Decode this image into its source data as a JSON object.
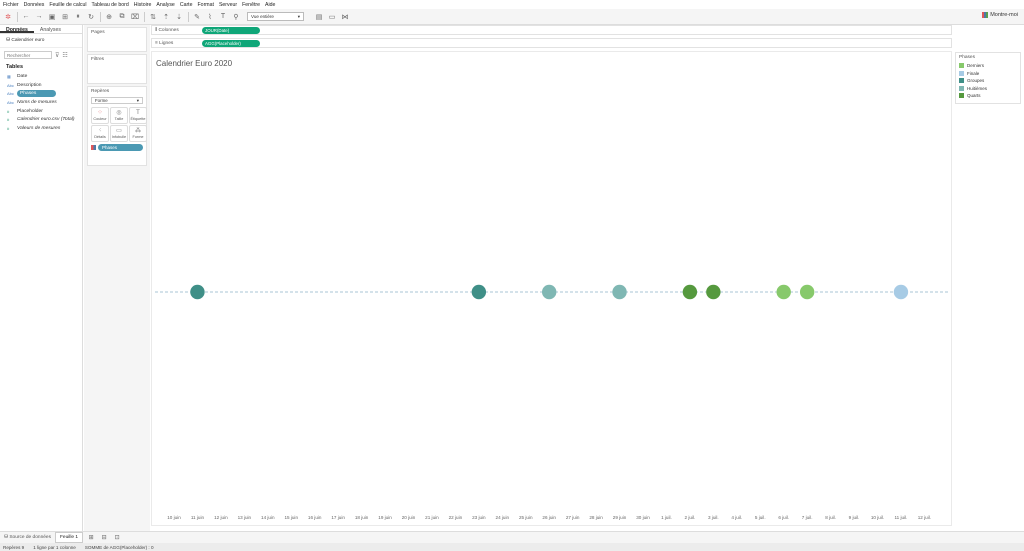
{
  "menu": [
    "Fichier",
    "Données",
    "Feuille de calcul",
    "Tableau de bord",
    "Histoire",
    "Analyse",
    "Carte",
    "Format",
    "Serveur",
    "Fenêtre",
    "Aide"
  ],
  "toolbar": {
    "view_select": "Vue entière",
    "show_me": "Montre-moi"
  },
  "left": {
    "tab_data": "Données",
    "tab_analysis": "Analyses",
    "datasource": "Calendrier euro",
    "search_placeholder": "Rechercher",
    "tables_title": "Tables",
    "fields": [
      {
        "name": "Date",
        "type": "date"
      },
      {
        "name": "Description",
        "type": "Abc"
      },
      {
        "name": "Phases",
        "type": "Abc"
      },
      {
        "name": "Noms de mesures",
        "type": "Abc"
      },
      {
        "name": "Placeholder",
        "type": "#"
      },
      {
        "name": "Calendrier euro.csv (Total)",
        "type": "#"
      },
      {
        "name": "Valeurs de mesures",
        "type": "#"
      }
    ]
  },
  "cards": {
    "pages": "Pages",
    "filters": "Filtres",
    "marks": "Repères",
    "mark_type": "Forme",
    "buttons": [
      "Couleur",
      "Taille",
      "Étiquette",
      "Détails",
      "Infobulle",
      "Forme"
    ],
    "phase_pill": "Phases"
  },
  "shelves": {
    "columns_label": "Colonnes",
    "columns_pill": "JOUR(Date)",
    "rows_label": "Lignes",
    "rows_pill": "AGG(Placeholder)"
  },
  "view": {
    "title": "Calendrier Euro 2020"
  },
  "legend": {
    "title": "Phases",
    "items": [
      {
        "label": "Derniers",
        "color": "#87c96b"
      },
      {
        "label": "Finale",
        "color": "#a7cbe5"
      },
      {
        "label": "Groupes",
        "color": "#3f8f87"
      },
      {
        "label": "Huitièmes",
        "color": "#7fb7b3"
      },
      {
        "label": "Quarts",
        "color": "#55993e"
      }
    ]
  },
  "chart_data": {
    "type": "scatter",
    "title": "Calendrier Euro 2020",
    "categories": [
      "10 juin",
      "11 juin",
      "12 juin",
      "13 juin",
      "14 juin",
      "15 juin",
      "16 juin",
      "17 juin",
      "18 juin",
      "19 juin",
      "20 juin",
      "21 juin",
      "22 juin",
      "23 juin",
      "24 juin",
      "25 juin",
      "26 juin",
      "27 juin",
      "28 juin",
      "29 juin",
      "30 juin",
      "1 juil.",
      "2 juil.",
      "3 juil.",
      "4 juil.",
      "5 juil.",
      "6 juil.",
      "7 juil.",
      "8 juil.",
      "9 juil.",
      "10 juil.",
      "11 juil.",
      "12 juil."
    ],
    "points": [
      {
        "x": "11 juin",
        "phase": "Groupes"
      },
      {
        "x": "23 juin",
        "phase": "Groupes"
      },
      {
        "x": "26 juin",
        "phase": "Huitièmes"
      },
      {
        "x": "29 juin",
        "phase": "Huitièmes"
      },
      {
        "x": "2 juil.",
        "phase": "Quarts"
      },
      {
        "x": "3 juil.",
        "phase": "Quarts"
      },
      {
        "x": "6 juil.",
        "phase": "Derniers"
      },
      {
        "x": "7 juil.",
        "phase": "Derniers"
      },
      {
        "x": "11 juil.",
        "phase": "Finale"
      }
    ]
  },
  "sheettabs": {
    "datasource": "Source de données",
    "sheet1": "Feuille 1"
  },
  "status": {
    "marks": "Repères 9",
    "rows": "1 ligne par 1 colonne",
    "sum": "SOMME de AGG(Placeholder) : 0"
  }
}
